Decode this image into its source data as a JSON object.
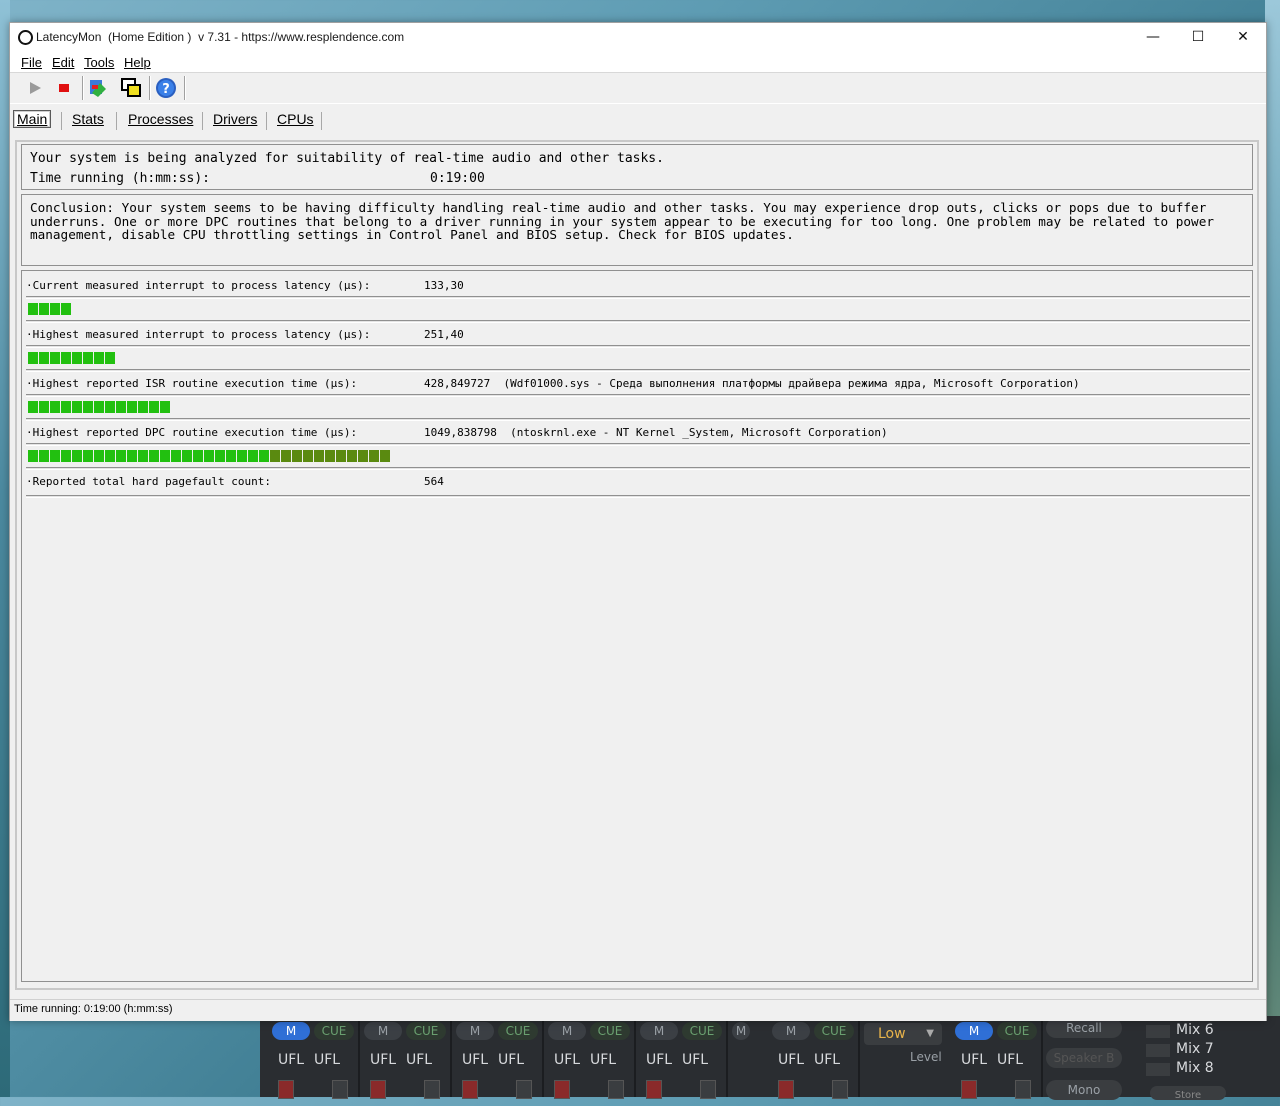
{
  "window": {
    "title": "LatencyMon  (Home Edition )  v 7.31 - https://www.resplendence.com",
    "controls": {
      "minimize": "—",
      "maximize": "☐",
      "close": "✕"
    }
  },
  "menu": [
    "File",
    "Edit",
    "Tools",
    "Help"
  ],
  "toolbar": {
    "buttons": [
      "play-icon",
      "stop-icon",
      "analyze-icon",
      "windows-icon",
      "help-icon"
    ]
  },
  "tabs": [
    "Main",
    "Stats",
    "Processes",
    "Drivers",
    "CPUs"
  ],
  "status": {
    "line1": "Your system is being analyzed for suitability of real-time audio and other tasks.",
    "line2_label": "Time running (h:mm:ss):",
    "line2_value": "0:19:00"
  },
  "conclusion": "Conclusion: Your system seems to be having difficulty handling real-time audio and other tasks. You may experience drop outs, clicks or pops due to buffer underruns. One or more DPC routines that belong to a driver running in your system appear to be executing for too long. One problem may be related to power management, disable CPU throttling settings in Control Panel and BIOS setup. Check for BIOS updates.",
  "metrics": [
    {
      "label": "·Current measured interrupt to process latency (µs):",
      "value": "133,30",
      "segments": 4,
      "color": "#22c010"
    },
    {
      "label": "·Highest measured interrupt to process latency (µs):",
      "value": "251,40",
      "segments": 8,
      "color": "#22c010"
    },
    {
      "label": "·Highest reported ISR routine execution time (µs):",
      "value": "428,849727  (Wdf01000.sys - Среда выполнения платформы драйвера режима ядра, Microsoft Corporation)",
      "segments": 13,
      "color": "#22c010"
    },
    {
      "label": "·Highest reported DPC routine execution time (µs):",
      "value": "1049,838798  (ntoskrnl.exe - NT Kernel _System, Microsoft Corporation)",
      "segments": 33,
      "color": "#22c010",
      "tail_color": "#5a8a10"
    },
    {
      "label": "·Reported total hard pagefault count:",
      "value": "564",
      "segments": 0,
      "color": "#22c010"
    }
  ],
  "statusbar": "Time running: 0:19:00  (h:mm:ss)",
  "mixer": {
    "m_label": "M",
    "cue_label": "CUE",
    "ufl_label": "UFL",
    "low_label": "Low",
    "level_label": "Level",
    "recall_label": "Recall",
    "speaker_label": "Speaker B",
    "mono_label": "Mono",
    "store_label": "Store",
    "mixes": [
      "Mix 6",
      "Mix 7",
      "Mix 8"
    ]
  },
  "colors": {
    "bar_green": "#22c010",
    "bar_olive": "#5a8a10",
    "accent_blue": "#2f6fd6"
  }
}
